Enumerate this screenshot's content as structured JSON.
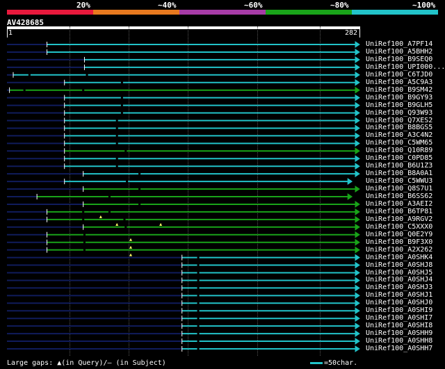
{
  "legend": {
    "labels": [
      "20%",
      "~40%",
      "~60%",
      "~80%",
      "~100%"
    ],
    "colors": [
      "#e8193c",
      "#e7791f",
      "#a63ba6",
      "#19a319",
      "#22c3c9"
    ]
  },
  "query": {
    "name": "AV428685",
    "start": "1",
    "end": "282"
  },
  "colors": {
    "cyan": "#22c3c9",
    "green": "#19a319",
    "navy": "#101c5c",
    "white": "#ffffff",
    "yellow": "#ffff66"
  },
  "chart_data": {
    "type": "alignment",
    "query_length": 282,
    "hits": [
      {
        "name": "UniRef100_A7PF14",
        "start": 32,
        "end": 282,
        "color": "cyan",
        "arrow": true,
        "markers": []
      },
      {
        "name": "UniRef100_A5BHH2",
        "start": 32,
        "end": 282,
        "color": "cyan",
        "arrow": true,
        "markers": []
      },
      {
        "name": "UniRef100_B9SEQ0",
        "start": 62,
        "end": 282,
        "color": "cyan",
        "arrow": true,
        "markers": []
      },
      {
        "name": "UniRef100_UPI000...",
        "start": 62,
        "end": 282,
        "color": "cyan",
        "arrow": true,
        "markers": []
      },
      {
        "name": "UniRef100_C6TJD0",
        "start": 5,
        "end": 282,
        "color": "cyan",
        "arrow": true,
        "markers": [
          18,
          64
        ]
      },
      {
        "name": "UniRef100_A5C9A3",
        "start": 46,
        "end": 282,
        "color": "cyan",
        "arrow": true,
        "markers": [
          92
        ]
      },
      {
        "name": "UniRef100_B9SM42",
        "start": 2,
        "end": 282,
        "color": "green",
        "arrow": true,
        "markers": [
          14,
          61
        ]
      },
      {
        "name": "UniRef100_B9GY93",
        "start": 46,
        "end": 282,
        "color": "cyan",
        "arrow": true,
        "markers": [
          92
        ]
      },
      {
        "name": "UniRef100_B9GLH5",
        "start": 46,
        "end": 282,
        "color": "cyan",
        "arrow": true,
        "markers": [
          92
        ]
      },
      {
        "name": "UniRef100_Q93W93",
        "start": 46,
        "end": 282,
        "color": "cyan",
        "arrow": true,
        "markers": [
          92
        ]
      },
      {
        "name": "UniRef100_Q7XES2",
        "start": 46,
        "end": 282,
        "color": "cyan",
        "arrow": true,
        "markers": [
          88
        ]
      },
      {
        "name": "UniRef100_B8BGS5",
        "start": 46,
        "end": 282,
        "color": "cyan",
        "arrow": true,
        "markers": [
          88
        ]
      },
      {
        "name": "UniRef100_A3C4N2",
        "start": 46,
        "end": 282,
        "color": "cyan",
        "arrow": true,
        "markers": [
          88
        ]
      },
      {
        "name": "UniRef100_C5WM65",
        "start": 46,
        "end": 282,
        "color": "cyan",
        "arrow": true,
        "markers": [
          88
        ]
      },
      {
        "name": "UniRef100_Q10R89",
        "start": 46,
        "end": 282,
        "color": "green",
        "arrow": true,
        "markers": [
          95
        ]
      },
      {
        "name": "UniRef100_C0PD85",
        "start": 46,
        "end": 282,
        "color": "cyan",
        "arrow": true,
        "markers": [
          88
        ]
      },
      {
        "name": "UniRef100_B6U1Z3",
        "start": 46,
        "end": 282,
        "color": "cyan",
        "arrow": true,
        "markers": [
          88
        ]
      },
      {
        "name": "UniRef100_B8A0A1",
        "start": 61,
        "end": 282,
        "color": "cyan",
        "arrow": true,
        "markers": [
          106
        ]
      },
      {
        "name": "UniRef100_C5WWU3",
        "start": 46,
        "end": 276,
        "color": "cyan",
        "arrow": true,
        "markers": [
          96
        ]
      },
      {
        "name": "UniRef100_Q8S7U1",
        "start": 61,
        "end": 282,
        "color": "green",
        "arrow": true,
        "markers": [
          106
        ]
      },
      {
        "name": "UniRef100_B6SS62",
        "start": 24,
        "end": 276,
        "color": "green",
        "arrow": true,
        "markers": [
          82
        ]
      },
      {
        "name": "UniRef100_A3AEI2",
        "start": 61,
        "end": 282,
        "color": "green",
        "arrow": true,
        "markers": [
          106
        ]
      },
      {
        "name": "UniRef100_B6TP81",
        "start": 32,
        "end": 282,
        "color": "green",
        "arrow": true,
        "markers": [
          61,
          82
        ]
      },
      {
        "name": "UniRef100_A9RGV2",
        "start": 32,
        "end": 282,
        "color": "green",
        "arrow": true,
        "markers": [
          61,
          94
        ]
      },
      {
        "name": "UniRef100_C5XXX0",
        "start": 61,
        "end": 282,
        "color": "green",
        "arrow": true,
        "markers": [
          95
        ]
      },
      {
        "name": "UniRef100_Q0E2Y9",
        "start": 32,
        "end": 282,
        "color": "green",
        "arrow": true,
        "markers": [
          62
        ]
      },
      {
        "name": "UniRef100_B9F3X0",
        "start": 32,
        "end": 282,
        "color": "green",
        "arrow": true,
        "markers": [
          62
        ]
      },
      {
        "name": "UniRef100_A2X262",
        "start": 32,
        "end": 282,
        "color": "green",
        "arrow": true,
        "markers": [
          62
        ]
      },
      {
        "name": "UniRef100_A0SHK4",
        "start": 140,
        "end": 282,
        "color": "cyan",
        "arrow": true,
        "markers": [
          153
        ]
      },
      {
        "name": "UniRef100_A0SHJ8",
        "start": 140,
        "end": 282,
        "color": "cyan",
        "arrow": true,
        "markers": [
          153
        ]
      },
      {
        "name": "UniRef100_A0SHJ5",
        "start": 140,
        "end": 282,
        "color": "cyan",
        "arrow": true,
        "markers": [
          153
        ]
      },
      {
        "name": "UniRef100_A0SHJ4",
        "start": 140,
        "end": 282,
        "color": "cyan",
        "arrow": true,
        "markers": [
          153
        ]
      },
      {
        "name": "UniRef100_A0SHJ3",
        "start": 140,
        "end": 282,
        "color": "cyan",
        "arrow": true,
        "markers": [
          153
        ]
      },
      {
        "name": "UniRef100_A0SHJ1",
        "start": 140,
        "end": 282,
        "color": "cyan",
        "arrow": true,
        "markers": [
          153
        ]
      },
      {
        "name": "UniRef100_A0SHJ0",
        "start": 140,
        "end": 282,
        "color": "cyan",
        "arrow": true,
        "markers": [
          153
        ]
      },
      {
        "name": "UniRef100_A0SHI9",
        "start": 140,
        "end": 282,
        "color": "cyan",
        "arrow": true,
        "markers": [
          153
        ]
      },
      {
        "name": "UniRef100_A0SHI7",
        "start": 140,
        "end": 282,
        "color": "cyan",
        "arrow": true,
        "markers": [
          153
        ]
      },
      {
        "name": "UniRef100_A0SHI8",
        "start": 140,
        "end": 282,
        "color": "cyan",
        "arrow": true,
        "markers": [
          153
        ]
      },
      {
        "name": "UniRef100_A0SHH9",
        "start": 140,
        "end": 282,
        "color": "cyan",
        "arrow": true,
        "markers": [
          153
        ]
      },
      {
        "name": "UniRef100_A0SHH8",
        "start": 140,
        "end": 282,
        "color": "cyan",
        "arrow": true,
        "markers": [
          153
        ]
      },
      {
        "name": "UniRef100_A0SHH7",
        "start": 140,
        "end": 282,
        "color": "cyan",
        "arrow": true,
        "markers": [
          153
        ]
      }
    ],
    "query_gaps": [
      {
        "row": 22,
        "pos": 75
      },
      {
        "row": 23,
        "pos": 88
      },
      {
        "row": 23,
        "pos": 123
      },
      {
        "row": 25,
        "pos": 99
      },
      {
        "row": 26,
        "pos": 99
      },
      {
        "row": 27,
        "pos": 99
      }
    ]
  },
  "footer": {
    "gaps_text": "Large gaps: ▲(in Query)/– (in Subject)",
    "scale_text": "=50char."
  }
}
